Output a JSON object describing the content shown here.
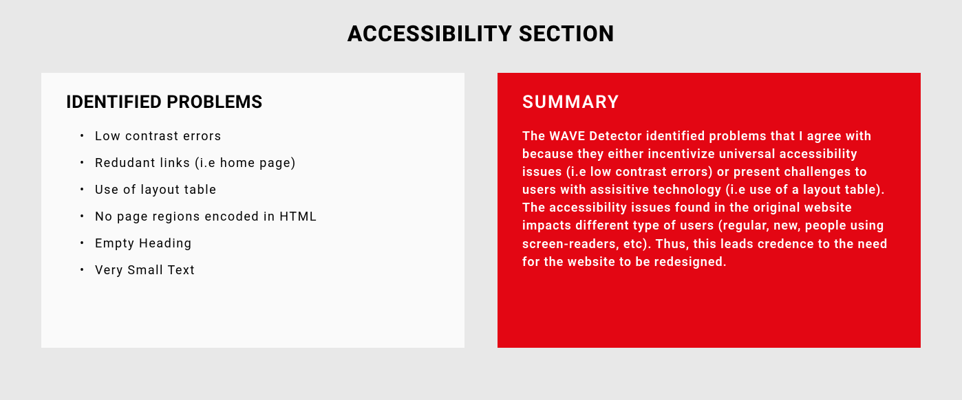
{
  "title": "ACCESSIBILITY SECTION",
  "left": {
    "heading": "IDENTIFIED PROBLEMS",
    "items": [
      "Low contrast errors",
      "Redudant links (i.e home page)",
      "Use of layout table",
      "No page regions encoded in HTML",
      "Empty Heading",
      "Very Small Text"
    ]
  },
  "right": {
    "heading": "SUMMARY",
    "text": "The WAVE Detector identified problems that I agree with because they either incentivize universal accessibility issues (i.e low contrast errors) or present challenges to users with assisitive technology (i.e use of a layout table). The accessibility issues found in the original website impacts different type of users (regular, new, people using screen-readers, etc). Thus, this leads credence to the need for the website to be redesigned."
  },
  "colors": {
    "background": "#e8e8e8",
    "card_left_bg": "#fafafa",
    "card_right_bg": "#e30613",
    "text_dark": "#000000",
    "text_light": "#ffffff"
  }
}
